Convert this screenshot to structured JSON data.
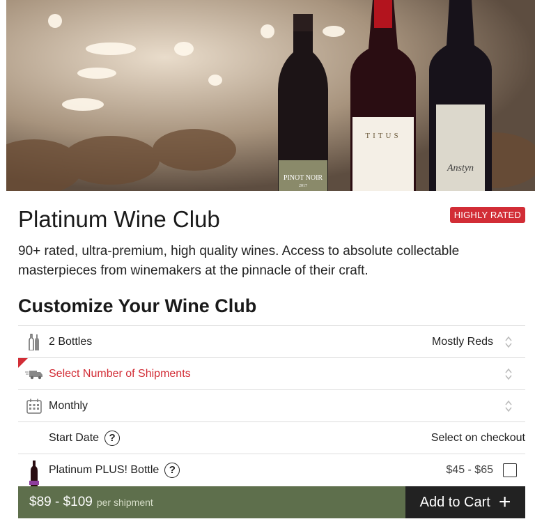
{
  "product": {
    "title": "Platinum Wine Club",
    "badge": "HIGHLY RATED",
    "description": "90+ rated, ultra-premium, high quality wines. Access to absolute collectable masterpieces from winemakers at the pinnacle of their craft."
  },
  "hero": {
    "bottle1_label": "PINOT NOIR",
    "bottle1_year": "2017",
    "bottle2_label": "TITUS",
    "bottle3_label": "Anstyn"
  },
  "customize": {
    "heading": "Customize Your Wine Club",
    "bottles": {
      "label": "2 Bottles",
      "value": "Mostly Reds",
      "icon": "bottles-icon"
    },
    "shipments": {
      "label": "Select Number of Shipments",
      "icon": "truck-icon"
    },
    "frequency": {
      "label": "Monthly",
      "icon": "calendar-icon"
    },
    "start_date": {
      "label": "Start Date",
      "help": "?",
      "value": "Select on checkout"
    },
    "plus_bottle": {
      "label": "Platinum PLUS! Bottle",
      "help": "?",
      "price": "$45 - $65",
      "checked": false,
      "icon": "plus-bottle-icon"
    }
  },
  "cart": {
    "price": "$89 - $109",
    "per": "per shipment",
    "button": "Add to Cart",
    "plus": "+"
  },
  "colors": {
    "accent_red": "#d22d36",
    "cart_green": "#5e6f4c",
    "cart_dark": "#222222"
  }
}
